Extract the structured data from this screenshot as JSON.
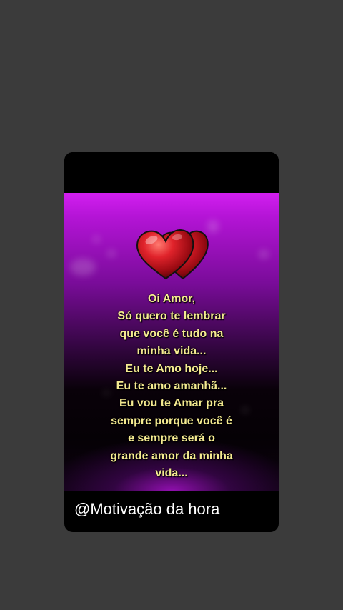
{
  "colors": {
    "background": "#3b3b3b",
    "card": "#000000",
    "gradient_top": "#d31ff0",
    "text": "#f4ea90",
    "caption_text": "#ffffff",
    "heart": "#c8141e"
  },
  "image": {
    "icon": "two-hearts-icon",
    "message_lines": [
      "Oi Amor,",
      "Só quero te lembrar",
      "que você é tudo na",
      "minha vida...",
      "Eu te Amo hoje...",
      "Eu te amo amanhã...",
      "Eu vou te Amar pra",
      "sempre porque você é",
      "e sempre será o",
      "grande amor da minha",
      "vida..."
    ]
  },
  "caption": "@Motivação da hora"
}
